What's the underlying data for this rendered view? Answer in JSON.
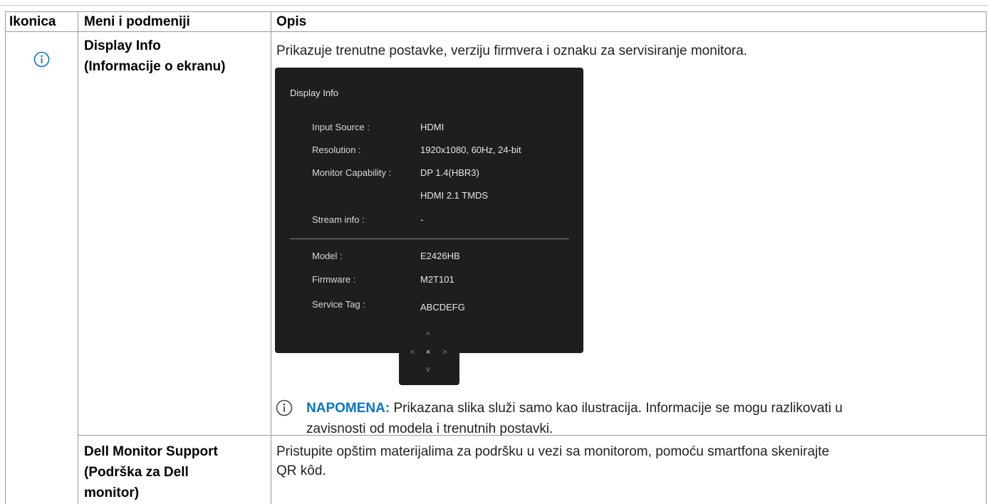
{
  "table": {
    "headers": {
      "icon": "Ikonica",
      "menu": "Meni i podmeniji",
      "desc": "Opis"
    }
  },
  "display_info": {
    "menu_line1": "Display Info",
    "menu_line2": "(Informacije o ekranu)",
    "description": "Prikazuje trenutne postavke, verziju firmvera i oznaku za servisiranje monitora.",
    "icon": "info-circle-icon"
  },
  "osd": {
    "title": "Display Info",
    "rows": [
      {
        "label": "Input Source :",
        "value": "HDMI"
      },
      {
        "label": "Resolution :",
        "value": "1920x1080, 60Hz, 24-bit"
      },
      {
        "label": "Monitor Capability :",
        "value": "DP 1.4(HBR3)"
      },
      {
        "label": "",
        "value": "HDMI 2.1 TMDS"
      },
      {
        "label": "Stream info :",
        "value": "-"
      },
      {
        "label": "Model :",
        "value": "E2426HB"
      },
      {
        "label": "Firmware :",
        "value": "M2T101"
      },
      {
        "label": "Service Tag :",
        "value": "ABCDEFG"
      }
    ],
    "joystick": {
      "up": "^",
      "left": "<",
      "center": "×",
      "right": ">",
      "down": "v"
    }
  },
  "note": {
    "label": "NAPOMENA:",
    "line1": " Prikazana slika služi samo kao ilustracija. Informacije se mogu razlikovati u",
    "line2": "zavisnosti od modela i trenutnih postavki.",
    "icon": "info-circle-icon"
  },
  "dell_support": {
    "menu_line1": "Dell Monitor Support",
    "menu_line2": "(Podrška za Dell",
    "menu_line3": "monitor)",
    "desc_line1": "Pristupite opštim materijalima za podršku u vezi sa monitorom, pomoću smartfona skenirajte",
    "desc_line2": "QR kôd."
  },
  "colors": {
    "accent_blue": "#0b74c5",
    "osd_background": "#1e1e1e",
    "grid_lines": "#9a9a9a"
  }
}
